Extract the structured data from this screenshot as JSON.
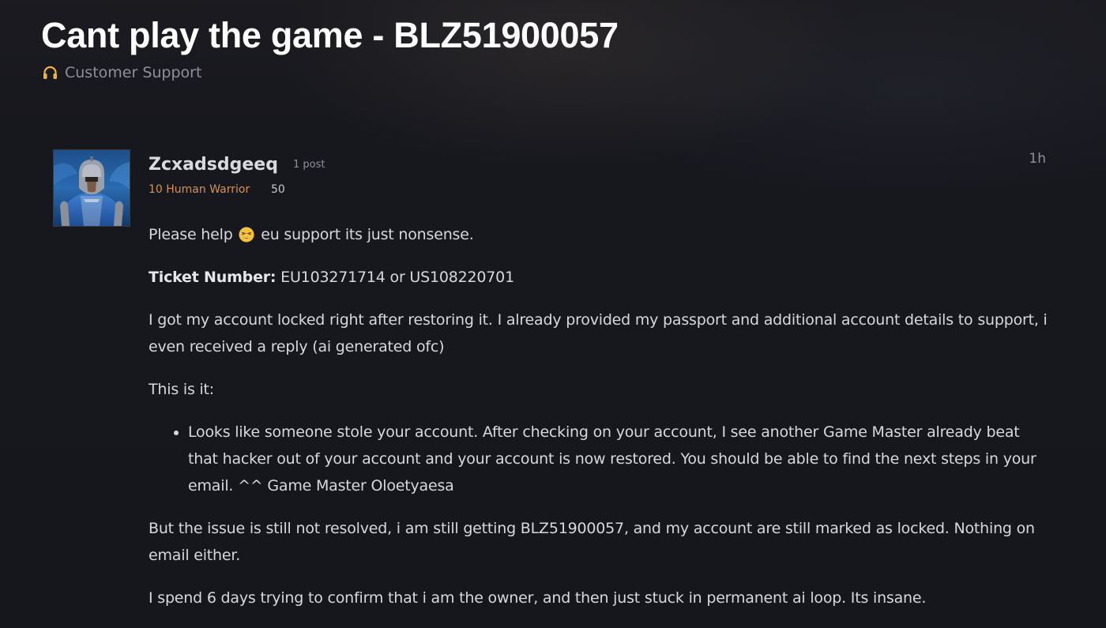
{
  "topic": {
    "title": "Cant play the game - BLZ51900057",
    "category": "Customer Support",
    "category_icon": "headset-icon"
  },
  "post": {
    "author": {
      "username": "Zcxadsdgeeq",
      "post_count": "1 post",
      "character": "10 Human Warrior",
      "achievement_points": "50",
      "avatar": "warrior-avatar"
    },
    "time": "1h",
    "paragraph_1": {
      "before_emoji": "Please help",
      "emoji": "tired-face-emoji",
      "after_emoji": "eu support its just nonsense."
    },
    "ticket": {
      "label": "Ticket Number:",
      "value": "EU103271714 or US108220701"
    },
    "paragraph_3": "I got my account locked right after restoring it. I already provided my passport and additional account details to support, i even received a reply (ai generated ofc)",
    "paragraph_4": "This is it:",
    "quote_item": "Looks like someone stole your account. After checking on your account, I see another Game Master already beat that hacker out of your account and your account is now restored. You should be able to find the next steps in your email. ^^ Game Master Oloetyaesa",
    "paragraph_5": "But the issue is still not resolved, i am still getting BLZ51900057, and my account are still marked as locked. Nothing on email either.",
    "paragraph_6": "I spend 6 days trying to confirm that i am the owner, and then just stuck in permanent ai loop. Its insane."
  },
  "colors": {
    "background": "#15161c",
    "title": "#ffffff",
    "body_text": "#d8d8dc",
    "muted": "#8f9099",
    "character_class": "#d3925c",
    "headset_accent": "#f0b33a"
  }
}
